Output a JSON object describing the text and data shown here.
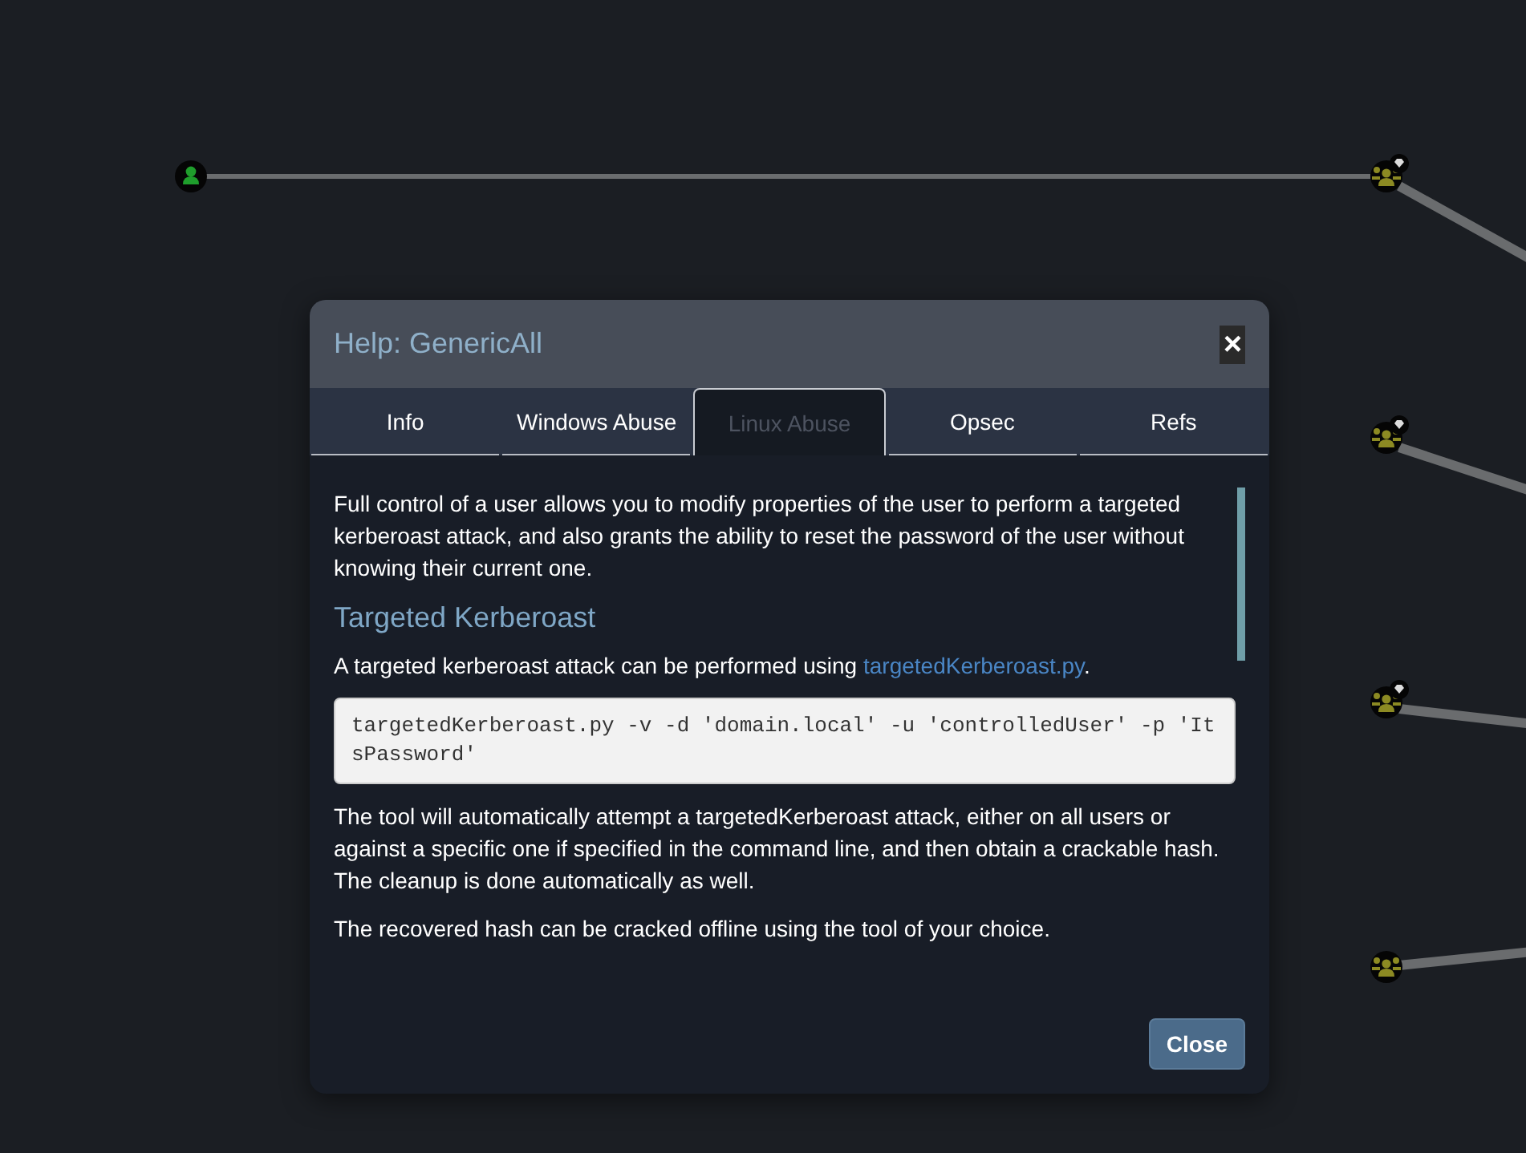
{
  "graph": {
    "nodes": [
      {
        "kind": "user",
        "badge": false
      },
      {
        "kind": "group",
        "badge": true
      },
      {
        "kind": "group",
        "badge": true
      },
      {
        "kind": "group",
        "badge": true
      },
      {
        "kind": "group",
        "badge": false
      }
    ]
  },
  "dialog": {
    "title": "Help: GenericAll",
    "close_glyph": "×",
    "tabs": [
      {
        "label": "Info",
        "selected": false
      },
      {
        "label": "Windows Abuse",
        "selected": false
      },
      {
        "label": "Linux Abuse",
        "selected": true
      },
      {
        "label": "Opsec",
        "selected": false
      },
      {
        "label": "Refs",
        "selected": false
      }
    ],
    "blocks": [
      {
        "kind": "paragraph",
        "text": "Full control of a user allows you to modify properties of the user to perform a targeted kerberoast attack, and also grants the ability to reset the password of the user without knowing their current one."
      },
      {
        "kind": "heading",
        "text": "Targeted Kerberoast"
      },
      {
        "kind": "paragraph",
        "text": "A targeted kerberoast attack can be performed using ",
        "link": "targetedKerberoast.py",
        "after": "."
      },
      {
        "kind": "code",
        "text": "targetedKerberoast.py -v -d 'domain.local' -u 'controlledUser' -p 'ItsPassword'"
      },
      {
        "kind": "paragraph",
        "text": "The tool will automatically attempt a targetedKerberoast attack, either on all users or against a specific one if specified in the command line, and then obtain a crackable hash. The cleanup is done automatically as well."
      },
      {
        "kind": "paragraph",
        "text": "The recovered hash can be cracked offline using the tool of your choice."
      }
    ],
    "footer_button": "Close"
  }
}
